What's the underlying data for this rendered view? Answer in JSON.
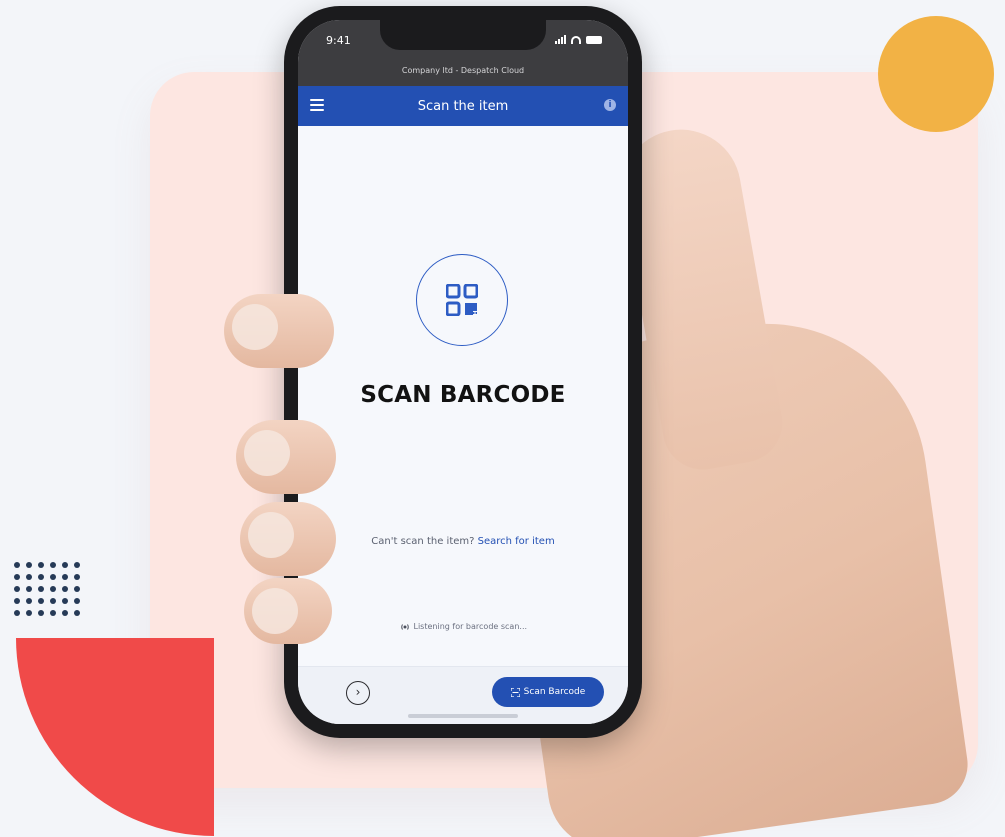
{
  "colors": {
    "background": "#f3f5f9",
    "card": "#fde6e1",
    "accent_orange": "#f2b245",
    "accent_red": "#f04a49",
    "brand_blue": "#2350b3"
  },
  "status_bar": {
    "time": "9:41",
    "company": "Company ltd - Despatch Cloud"
  },
  "app_bar": {
    "title": "Scan the item",
    "menu_icon": "hamburger-icon",
    "info_icon": "info-icon",
    "info_glyph": "i"
  },
  "main": {
    "scan_icon": "qr-code-icon",
    "heading": "SCAN BARCODE",
    "cant_scan_text": "Can't scan the item?",
    "search_link": "Search for item",
    "listening_text": "Listening for barcode scan..."
  },
  "bottom_bar": {
    "next_glyph": "›",
    "scan_button_label": "Scan Barcode"
  }
}
